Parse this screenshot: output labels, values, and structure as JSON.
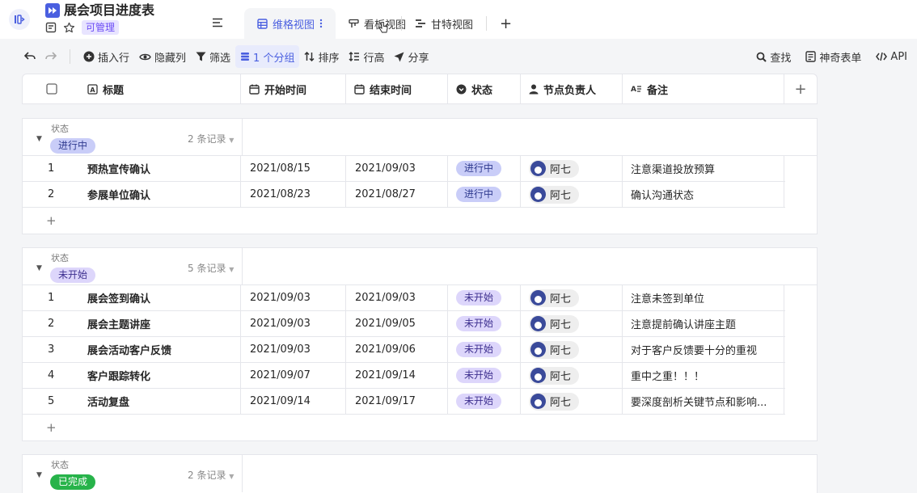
{
  "header": {
    "title": "展会项目进度表",
    "permission": "可管理",
    "tabs": [
      {
        "label": "维格视图"
      },
      {
        "label": "看板视图"
      },
      {
        "label": "甘特视图"
      }
    ],
    "tab_add": "+"
  },
  "toolbar": {
    "insert_row": "插入行",
    "hide_columns": "隐藏列",
    "filter": "筛选",
    "group": "1 个分组",
    "sort": "排序",
    "row_height": "行高",
    "share": "分享",
    "search": "查找",
    "form": "神奇表单",
    "api": "API"
  },
  "columns": {
    "title": "标题",
    "start": "开始时间",
    "end": "结束时间",
    "status": "状态",
    "owner": "节点负责人",
    "note": "备注",
    "add": "+"
  },
  "colors": {
    "accent": "#4a5fe0",
    "status_in_progress_bg": "#c9cdf8",
    "status_not_started_bg": "#ddd6fb",
    "status_done_bg": "#27b34a"
  },
  "groups": [
    {
      "field": "状态",
      "tag": "进行中",
      "count": "2 条记录",
      "rows": [
        {
          "idx": "1",
          "title": "预热宣传确认",
          "start": "2021/08/15",
          "end": "2021/09/03",
          "status": "进行中",
          "owner": "阿七",
          "note": "注意渠道投放预算"
        },
        {
          "idx": "2",
          "title": "参展单位确认",
          "start": "2021/08/23",
          "end": "2021/08/27",
          "status": "进行中",
          "owner": "阿七",
          "note": "确认沟通状态"
        }
      ]
    },
    {
      "field": "状态",
      "tag": "未开始",
      "count": "5 条记录",
      "rows": [
        {
          "idx": "1",
          "title": "展会签到确认",
          "start": "2021/09/03",
          "end": "2021/09/03",
          "status": "未开始",
          "owner": "阿七",
          "note": "注意未签到单位"
        },
        {
          "idx": "2",
          "title": "展会主题讲座",
          "start": "2021/09/03",
          "end": "2021/09/05",
          "status": "未开始",
          "owner": "阿七",
          "note": "注意提前确认讲座主题"
        },
        {
          "idx": "3",
          "title": "展会活动客户反馈",
          "start": "2021/09/03",
          "end": "2021/09/06",
          "status": "未开始",
          "owner": "阿七",
          "note": "对于客户反馈要十分的重视"
        },
        {
          "idx": "4",
          "title": "客户跟踪转化",
          "start": "2021/09/07",
          "end": "2021/09/14",
          "status": "未开始",
          "owner": "阿七",
          "note": "重中之重！！！"
        },
        {
          "idx": "5",
          "title": "活动复盘",
          "start": "2021/09/14",
          "end": "2021/09/17",
          "status": "未开始",
          "owner": "阿七",
          "note": "要深度剖析关键节点和影响..."
        }
      ]
    },
    {
      "field": "状态",
      "tag": "已完成",
      "count": "2 条记录",
      "rows": []
    }
  ],
  "add_row": "+"
}
